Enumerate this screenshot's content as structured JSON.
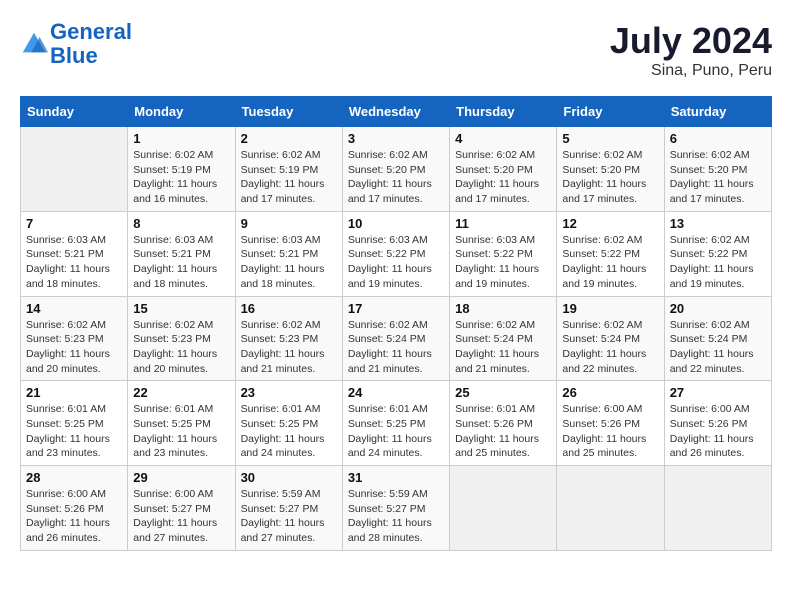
{
  "header": {
    "logo_line1": "General",
    "logo_line2": "Blue",
    "month": "July 2024",
    "location": "Sina, Puno, Peru"
  },
  "weekdays": [
    "Sunday",
    "Monday",
    "Tuesday",
    "Wednesday",
    "Thursday",
    "Friday",
    "Saturday"
  ],
  "weeks": [
    [
      {
        "day": "",
        "empty": true
      },
      {
        "day": "1",
        "sunrise": "6:02 AM",
        "sunset": "5:19 PM",
        "daylight": "11 hours and 16 minutes."
      },
      {
        "day": "2",
        "sunrise": "6:02 AM",
        "sunset": "5:19 PM",
        "daylight": "11 hours and 17 minutes."
      },
      {
        "day": "3",
        "sunrise": "6:02 AM",
        "sunset": "5:20 PM",
        "daylight": "11 hours and 17 minutes."
      },
      {
        "day": "4",
        "sunrise": "6:02 AM",
        "sunset": "5:20 PM",
        "daylight": "11 hours and 17 minutes."
      },
      {
        "day": "5",
        "sunrise": "6:02 AM",
        "sunset": "5:20 PM",
        "daylight": "11 hours and 17 minutes."
      },
      {
        "day": "6",
        "sunrise": "6:02 AM",
        "sunset": "5:20 PM",
        "daylight": "11 hours and 17 minutes."
      }
    ],
    [
      {
        "day": "7",
        "sunrise": "6:03 AM",
        "sunset": "5:21 PM",
        "daylight": "11 hours and 18 minutes."
      },
      {
        "day": "8",
        "sunrise": "6:03 AM",
        "sunset": "5:21 PM",
        "daylight": "11 hours and 18 minutes."
      },
      {
        "day": "9",
        "sunrise": "6:03 AM",
        "sunset": "5:21 PM",
        "daylight": "11 hours and 18 minutes."
      },
      {
        "day": "10",
        "sunrise": "6:03 AM",
        "sunset": "5:22 PM",
        "daylight": "11 hours and 19 minutes."
      },
      {
        "day": "11",
        "sunrise": "6:03 AM",
        "sunset": "5:22 PM",
        "daylight": "11 hours and 19 minutes."
      },
      {
        "day": "12",
        "sunrise": "6:02 AM",
        "sunset": "5:22 PM",
        "daylight": "11 hours and 19 minutes."
      },
      {
        "day": "13",
        "sunrise": "6:02 AM",
        "sunset": "5:22 PM",
        "daylight": "11 hours and 19 minutes."
      }
    ],
    [
      {
        "day": "14",
        "sunrise": "6:02 AM",
        "sunset": "5:23 PM",
        "daylight": "11 hours and 20 minutes."
      },
      {
        "day": "15",
        "sunrise": "6:02 AM",
        "sunset": "5:23 PM",
        "daylight": "11 hours and 20 minutes."
      },
      {
        "day": "16",
        "sunrise": "6:02 AM",
        "sunset": "5:23 PM",
        "daylight": "11 hours and 21 minutes."
      },
      {
        "day": "17",
        "sunrise": "6:02 AM",
        "sunset": "5:24 PM",
        "daylight": "11 hours and 21 minutes."
      },
      {
        "day": "18",
        "sunrise": "6:02 AM",
        "sunset": "5:24 PM",
        "daylight": "11 hours and 21 minutes."
      },
      {
        "day": "19",
        "sunrise": "6:02 AM",
        "sunset": "5:24 PM",
        "daylight": "11 hours and 22 minutes."
      },
      {
        "day": "20",
        "sunrise": "6:02 AM",
        "sunset": "5:24 PM",
        "daylight": "11 hours and 22 minutes."
      }
    ],
    [
      {
        "day": "21",
        "sunrise": "6:01 AM",
        "sunset": "5:25 PM",
        "daylight": "11 hours and 23 minutes."
      },
      {
        "day": "22",
        "sunrise": "6:01 AM",
        "sunset": "5:25 PM",
        "daylight": "11 hours and 23 minutes."
      },
      {
        "day": "23",
        "sunrise": "6:01 AM",
        "sunset": "5:25 PM",
        "daylight": "11 hours and 24 minutes."
      },
      {
        "day": "24",
        "sunrise": "6:01 AM",
        "sunset": "5:25 PM",
        "daylight": "11 hours and 24 minutes."
      },
      {
        "day": "25",
        "sunrise": "6:01 AM",
        "sunset": "5:26 PM",
        "daylight": "11 hours and 25 minutes."
      },
      {
        "day": "26",
        "sunrise": "6:00 AM",
        "sunset": "5:26 PM",
        "daylight": "11 hours and 25 minutes."
      },
      {
        "day": "27",
        "sunrise": "6:00 AM",
        "sunset": "5:26 PM",
        "daylight": "11 hours and 26 minutes."
      }
    ],
    [
      {
        "day": "28",
        "sunrise": "6:00 AM",
        "sunset": "5:26 PM",
        "daylight": "11 hours and 26 minutes."
      },
      {
        "day": "29",
        "sunrise": "6:00 AM",
        "sunset": "5:27 PM",
        "daylight": "11 hours and 27 minutes."
      },
      {
        "day": "30",
        "sunrise": "5:59 AM",
        "sunset": "5:27 PM",
        "daylight": "11 hours and 27 minutes."
      },
      {
        "day": "31",
        "sunrise": "5:59 AM",
        "sunset": "5:27 PM",
        "daylight": "11 hours and 28 minutes."
      },
      {
        "day": "",
        "empty": true
      },
      {
        "day": "",
        "empty": true
      },
      {
        "day": "",
        "empty": true
      }
    ]
  ],
  "labels": {
    "sunrise": "Sunrise:",
    "sunset": "Sunset:",
    "daylight": "Daylight:"
  }
}
